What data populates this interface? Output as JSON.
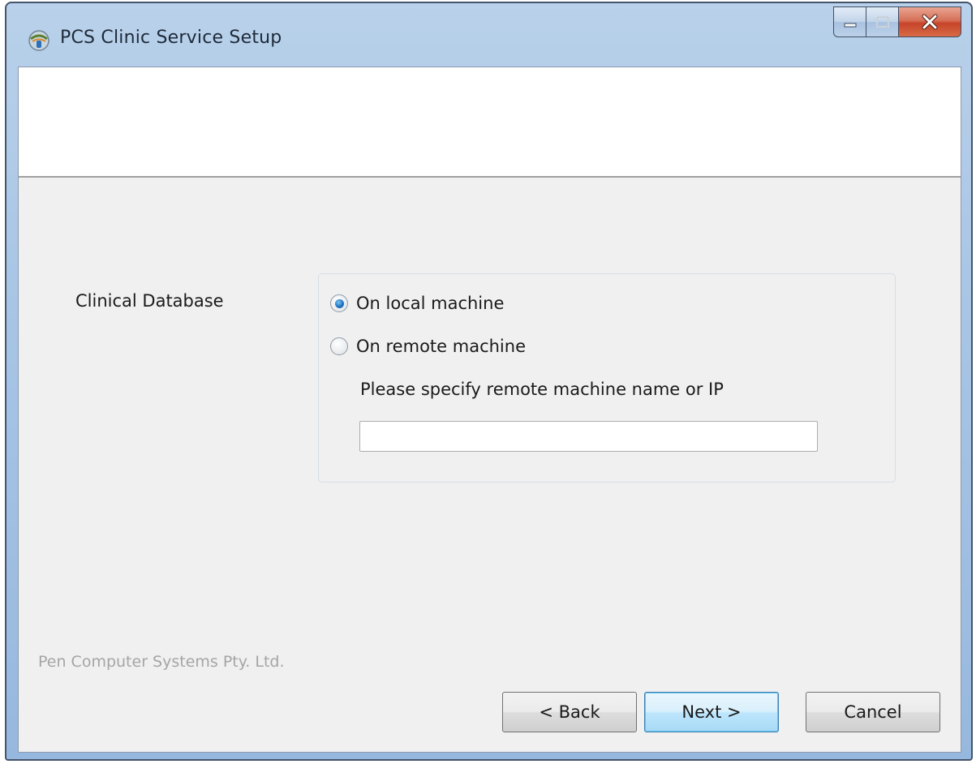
{
  "window": {
    "title": "PCS Clinic Service Setup",
    "controls": {
      "minimize": "minimize",
      "maximize": "maximize",
      "close": "close"
    }
  },
  "form": {
    "label": "Clinical Database",
    "options": [
      {
        "label": "On local machine",
        "checked": true
      },
      {
        "label": "On remote machine",
        "checked": false
      }
    ],
    "remote_hint": "Please specify remote machine name or IP",
    "remote_value": "",
    "remote_placeholder": ""
  },
  "footer": {
    "company": "Pen Computer Systems Pty. Ltd.",
    "back_label": "< Back",
    "next_label": "Next >",
    "cancel_label": "Cancel"
  },
  "colors": {
    "accent": "#1f74c1",
    "close_button": "#c7442a",
    "frame": "#a8c5e5"
  }
}
